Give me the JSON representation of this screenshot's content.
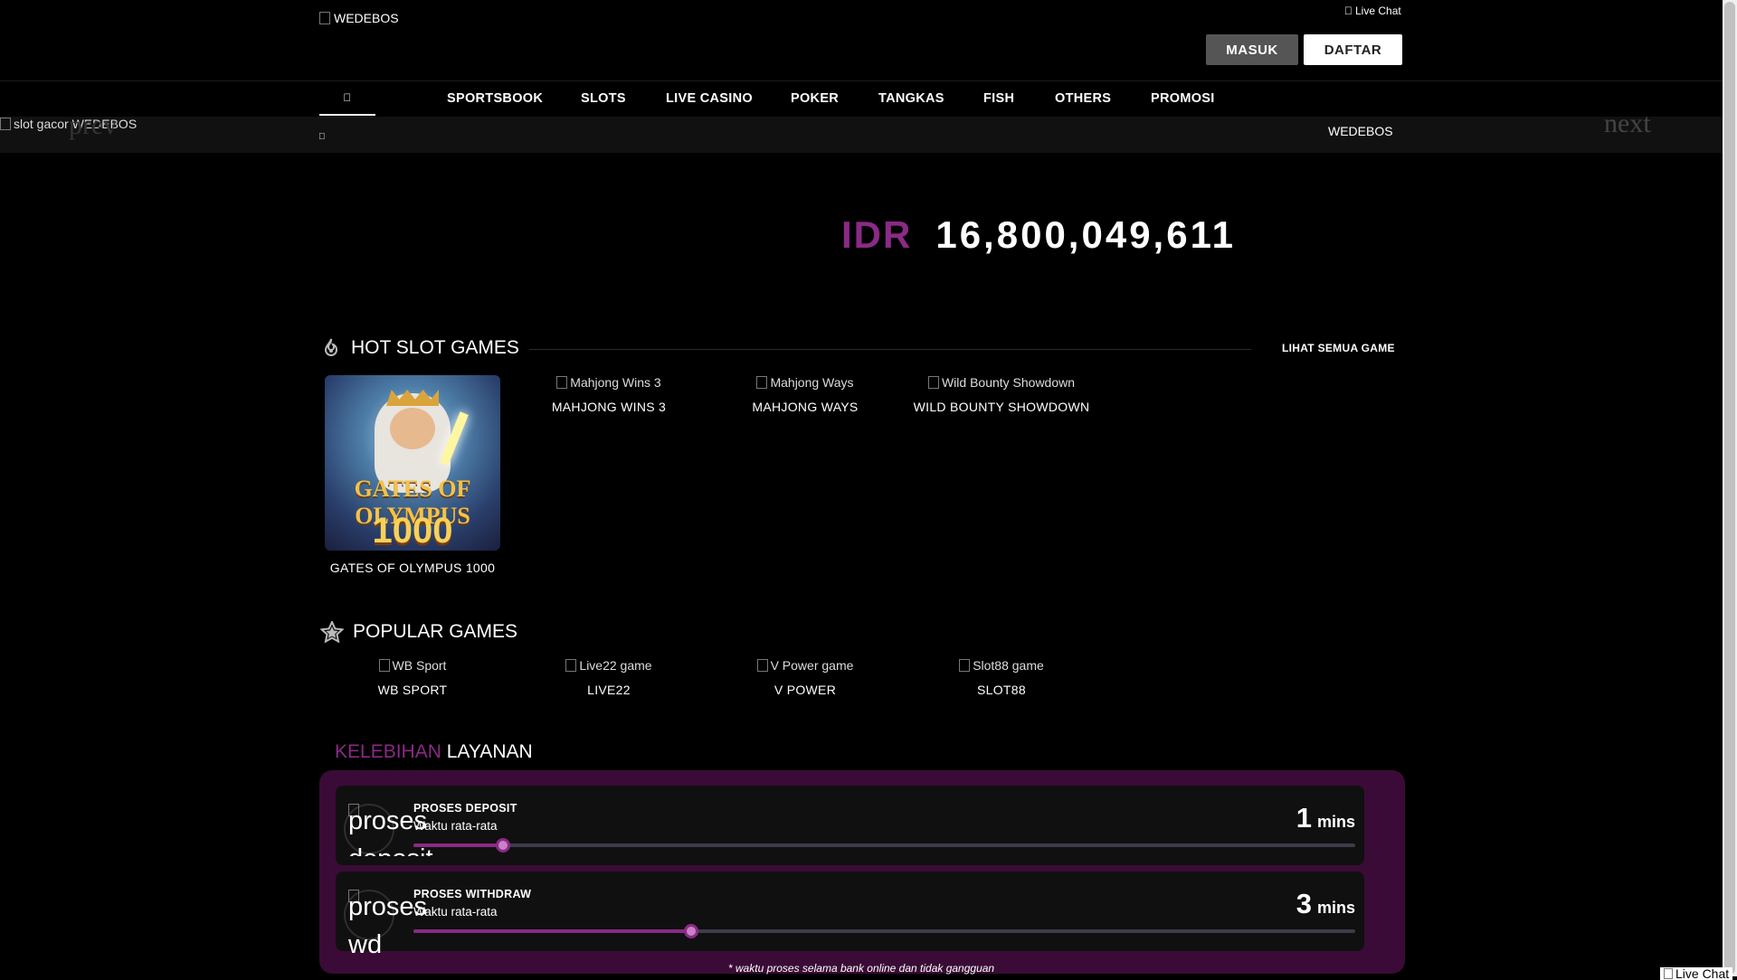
{
  "header": {
    "logo_alt": "WEDEBOS",
    "live_chat": "Live Chat",
    "login_label": "MASUK",
    "register_label": "DAFTAR"
  },
  "nav": {
    "items": [
      "SPORTSBOOK",
      "SLOTS",
      "LIVE CASINO",
      "POKER",
      "TANGKAS",
      "FISH",
      "OTHERS",
      "PROMOSI"
    ]
  },
  "banner": {
    "alt": "slot gacor WEDEBOS",
    "prev": "prev",
    "next": "next",
    "marquee_text": "WEDEBOS"
  },
  "jackpot": {
    "currency": "IDR",
    "value": "16,800,049,611"
  },
  "hot_slots": {
    "title": "HOT SLOT GAMES",
    "see_all": "LIHAT SEMUA GAME",
    "games": [
      {
        "alt": "",
        "name": "GATES OF OLYMPUS 1000",
        "thumb_title": "GATES OF OLYMPUS",
        "thumb_number": "1000"
      },
      {
        "alt": "Mahjong Wins 3",
        "name": "MAHJONG WINS 3"
      },
      {
        "alt": "Mahjong Ways",
        "name": "MAHJONG WAYS"
      },
      {
        "alt": "Wild Bounty Showdown",
        "name": "WILD BOUNTY SHOWDOWN"
      }
    ]
  },
  "popular": {
    "title": "POPULAR GAMES",
    "games": [
      {
        "alt": "WB Sport",
        "name": "WB SPORT"
      },
      {
        "alt": "Live22 game",
        "name": "LIVE22"
      },
      {
        "alt": "V Power game",
        "name": "V POWER"
      },
      {
        "alt": "Slot88 game",
        "name": "SLOT88"
      }
    ]
  },
  "kelebihan": {
    "title_a": "KELEBIHAN",
    "title_b": "LAYANAN",
    "items": [
      {
        "icon_alt": "proses deposit",
        "label": "PROSES DEPOSIT",
        "sub": "Waktu rata-rata",
        "value": "1",
        "unit": "mins",
        "progress": 0.095
      },
      {
        "icon_alt": "proses wd",
        "label": "PROSES WITHDRAW",
        "sub": "Waktu rata-rata",
        "value": "3",
        "unit": "mins",
        "progress": 0.295
      }
    ],
    "note": "* waktu proses selama bank online dan tidak gangguan"
  },
  "colors": {
    "accent": "#8a2a86",
    "panel": "#3a0b36",
    "background": "#000000"
  }
}
